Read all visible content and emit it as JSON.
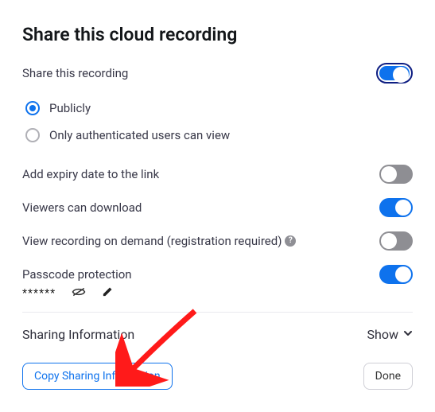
{
  "title": "Share this cloud recording",
  "share": {
    "label": "Share this recording",
    "on": true,
    "options": {
      "publicly": "Publicly",
      "authenticated": "Only authenticated users can view"
    },
    "selected": "publicly"
  },
  "expiry": {
    "label": "Add expiry date to the link",
    "on": false
  },
  "download": {
    "label": "Viewers can download",
    "on": true
  },
  "ondemand": {
    "label": "View recording on demand (registration required)",
    "on": false
  },
  "passcode": {
    "label": "Passcode protection",
    "on": true,
    "mask": "******"
  },
  "sharing_info": {
    "label": "Sharing Information",
    "toggle_label": "Show"
  },
  "buttons": {
    "copy": "Copy Sharing Information",
    "done": "Done"
  }
}
